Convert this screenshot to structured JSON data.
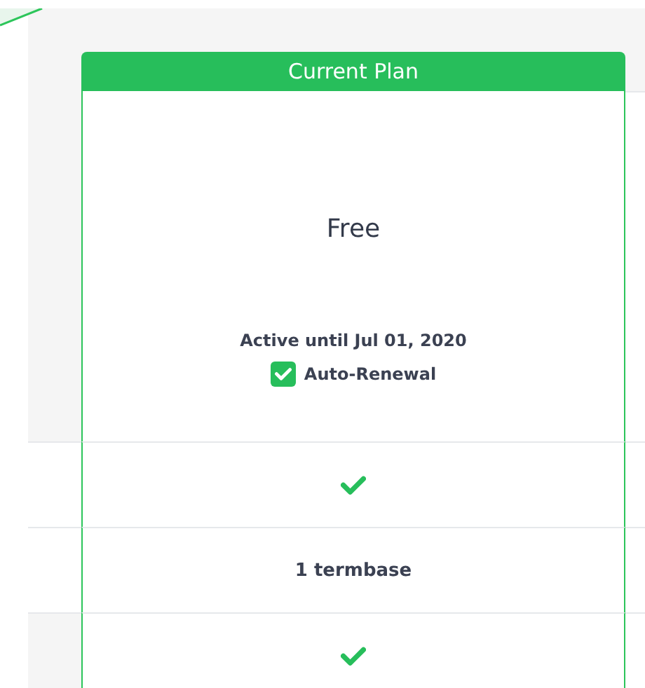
{
  "plan": {
    "header": "Current Plan",
    "name": "Free",
    "status": "Active until Jul 01, 2020",
    "auto_renewal": {
      "label": "Auto-Renewal",
      "checked": true
    }
  },
  "rows": [
    {
      "kind": "check"
    },
    {
      "kind": "text",
      "text": "1 termbase"
    },
    {
      "kind": "check"
    }
  ]
}
